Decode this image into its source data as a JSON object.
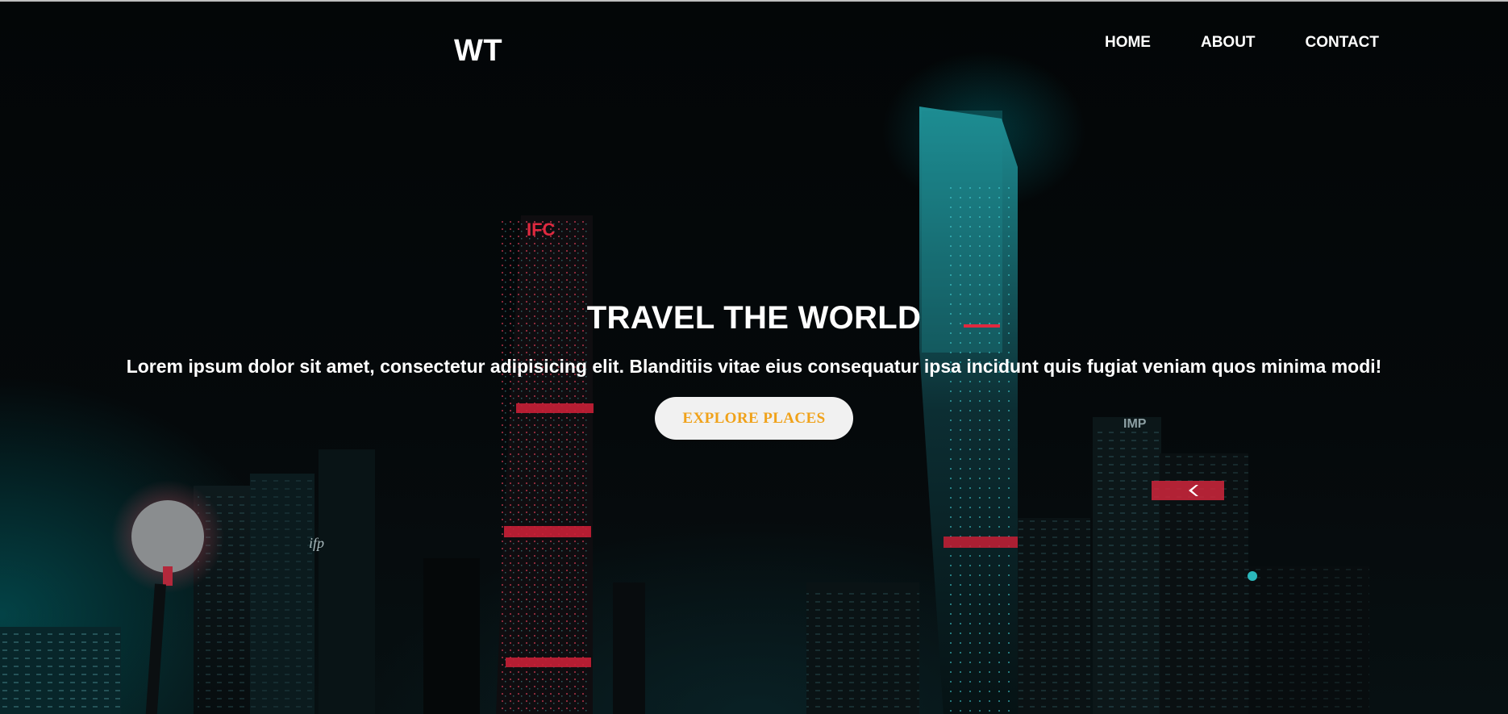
{
  "navbar": {
    "logo": "WT",
    "links": [
      "HOME",
      "ABOUT",
      "CONTACT"
    ]
  },
  "hero": {
    "title": "TRAVEL THE WORLD",
    "text": "Lorem ipsum dolor sit amet, consectetur adipisicing elit. Blanditiis vitae eius consequatur ipsa incidunt quis fugiat veniam quos minima modi!",
    "button_label": "EXPLORE PLACES",
    "background_image": "night-city-skyline",
    "building_signs": [
      "IFC",
      "ifp",
      "IMP"
    ]
  },
  "colors": {
    "text": "#ffffff",
    "button_bg": "#f1f1f1",
    "button_text": "#f0a21a",
    "neon_teal": "#1fb3b8",
    "neon_red": "#e0293f"
  }
}
